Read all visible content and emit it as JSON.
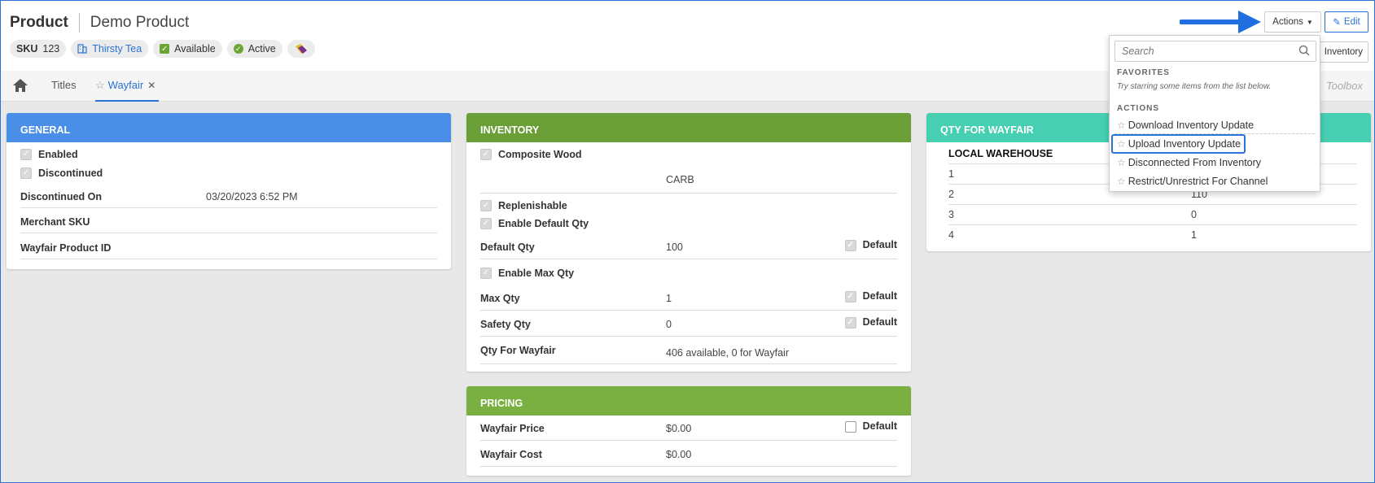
{
  "header": {
    "title": "Product",
    "product_name": "Demo Product",
    "badges": {
      "sku_label": "SKU",
      "sku_value": "123",
      "brand": "Thirsty Tea",
      "available": "Available",
      "active": "Active"
    }
  },
  "tabs": {
    "titles": "Titles",
    "wayfair": "Wayfair",
    "toolbox": "Toolbox"
  },
  "buttons": {
    "actions": "Actions",
    "edit": "Edit",
    "inventory_partial": "Inventory"
  },
  "dropdown": {
    "search_placeholder": "Search",
    "favorites_title": "FAVORITES",
    "favorites_hint": "Try starring some items from the list below.",
    "actions_title": "ACTIONS",
    "items": [
      "Download Inventory Update",
      "Upload Inventory Update",
      "Disconnected From Inventory",
      "Restrict/Unrestrict For Channel"
    ]
  },
  "general": {
    "title": "GENERAL",
    "enabled": "Enabled",
    "discontinued": "Discontinued",
    "discontinued_on_label": "Discontinued On",
    "discontinued_on_value": "03/20/2023 6:52 PM",
    "merchant_sku_label": "Merchant SKU",
    "wayfair_product_id_label": "Wayfair Product ID"
  },
  "inventory": {
    "title": "INVENTORY",
    "composite_wood": "Composite Wood",
    "carb": "CARB",
    "replenishable": "Replenishable",
    "enable_default_qty": "Enable Default Qty",
    "default_qty_label": "Default Qty",
    "default_qty_value": "100",
    "default_label": "Default",
    "enable_max_qty": "Enable Max Qty",
    "max_qty_label": "Max Qty",
    "max_qty_value": "1",
    "safety_qty_label": "Safety Qty",
    "safety_qty_value": "0",
    "qty_for_wayfair_label": "Qty For Wayfair",
    "qty_for_wayfair_value": "406 available, 0 for Wayfair"
  },
  "pricing": {
    "title": "PRICING",
    "price_label": "Wayfair Price",
    "price_value": "$0.00",
    "cost_label": "Wayfair Cost",
    "cost_value": "$0.00",
    "default_label": "Default"
  },
  "qty_wayfair": {
    "title": "QTY FOR WAYFAIR",
    "col_warehouse": "LOCAL WAREHOUSE",
    "rows": [
      {
        "warehouse": "1",
        "qty": ""
      },
      {
        "warehouse": "2",
        "qty": "110"
      },
      {
        "warehouse": "3",
        "qty": "0"
      },
      {
        "warehouse": "4",
        "qty": "1"
      }
    ]
  },
  "colors": {
    "general_header": "#4a8fe7",
    "inventory_header": "#6a9e36",
    "pricing_header": "#79b041",
    "qty_header": "#47cfb2",
    "accent": "#2a72d6"
  }
}
